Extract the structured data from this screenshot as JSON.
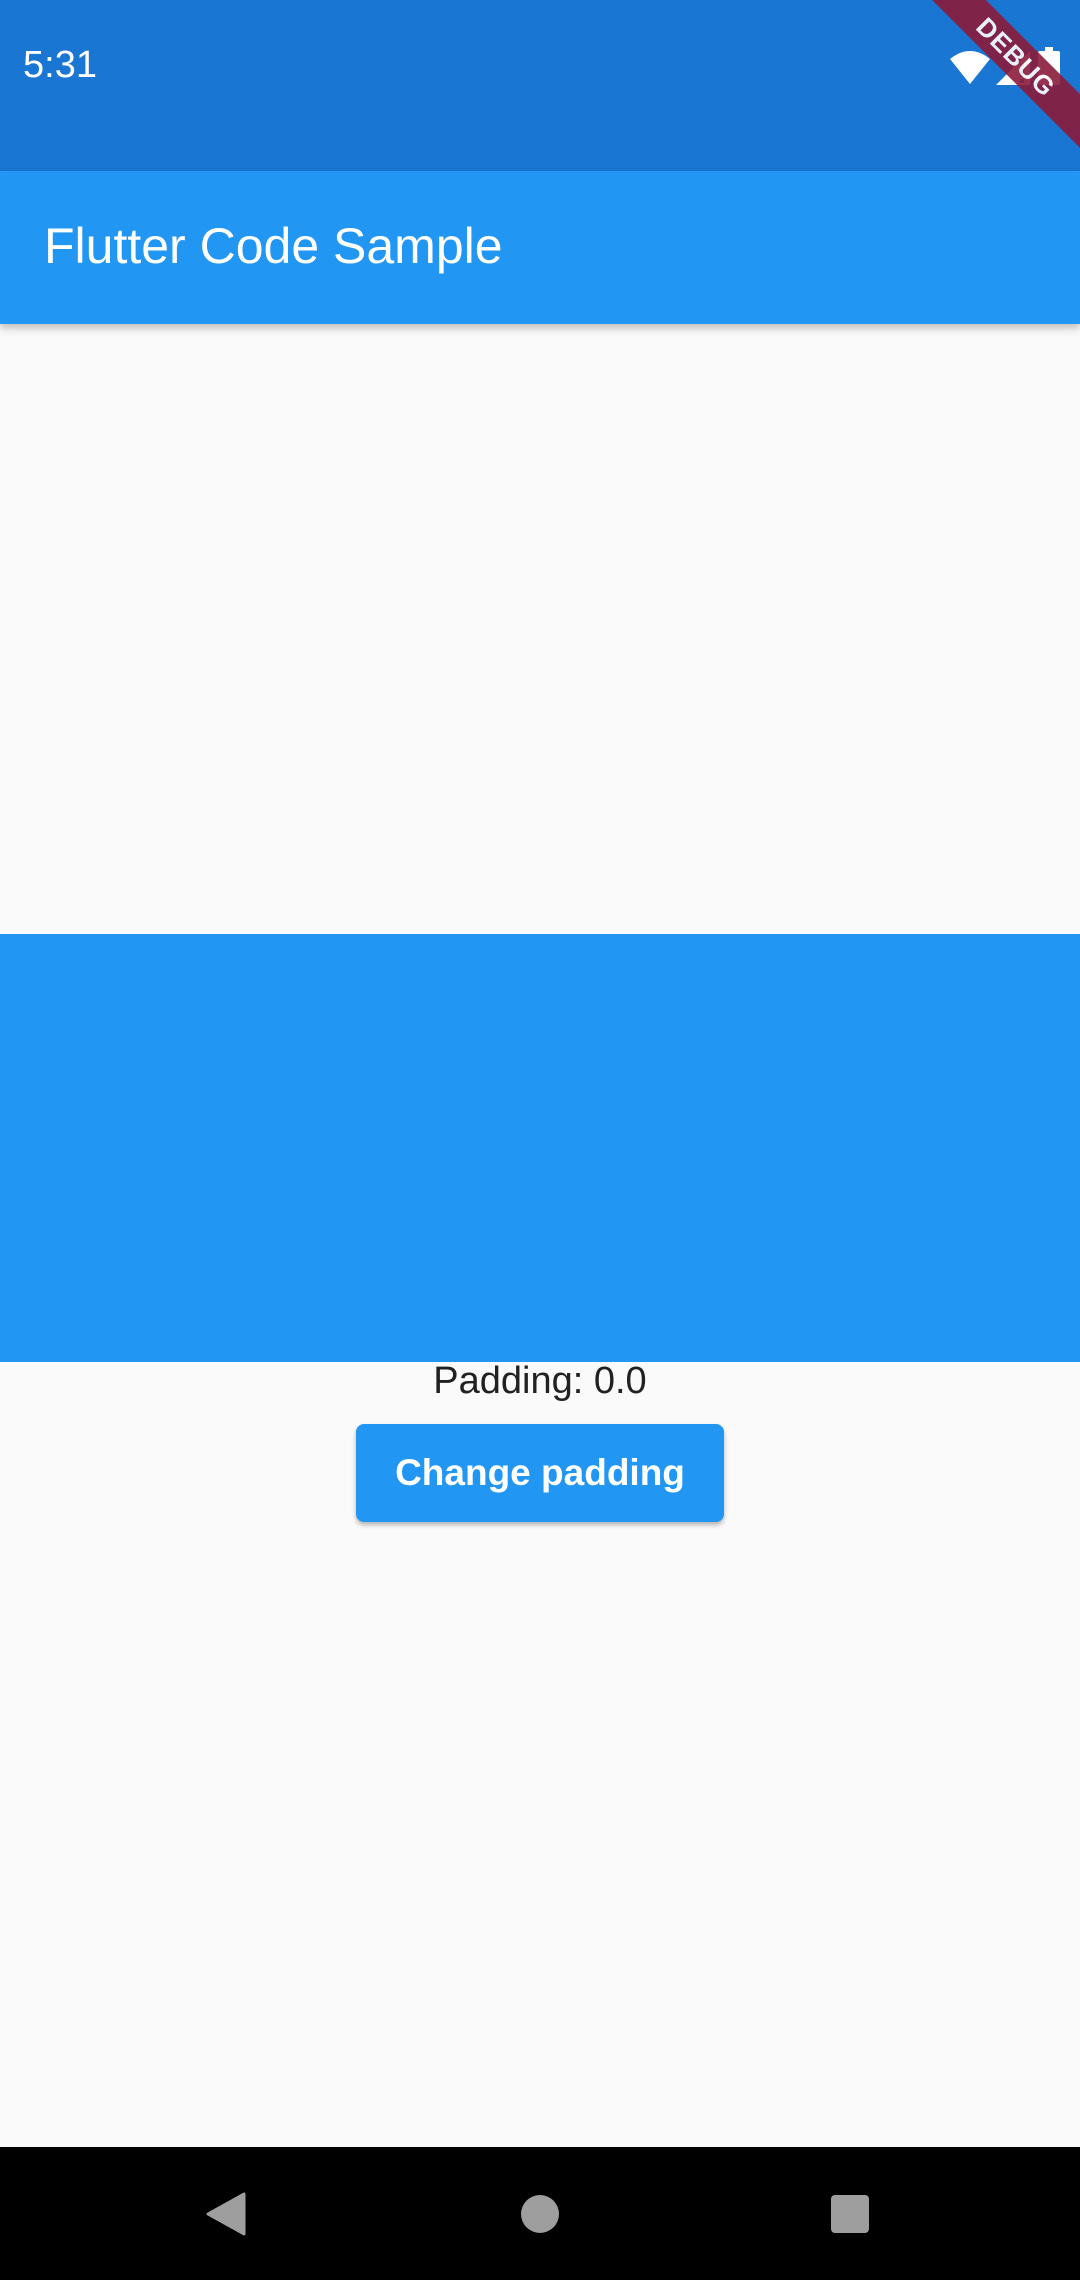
{
  "status_bar": {
    "time": "5:31",
    "icons": [
      "wifi-icon",
      "cell-signal-icon",
      "battery-icon"
    ],
    "background": "#1976D2"
  },
  "debug_banner": {
    "label": "DEBUG",
    "color": "#8B1B3B"
  },
  "app_bar": {
    "title": "Flutter Code Sample",
    "background": "#2196F3"
  },
  "main": {
    "block_color": "#2196F3",
    "padding_label": "Padding: 0.0",
    "button_label": "Change padding"
  },
  "nav_bar": {
    "buttons": [
      "back-icon",
      "home-icon",
      "recents-icon"
    ]
  }
}
